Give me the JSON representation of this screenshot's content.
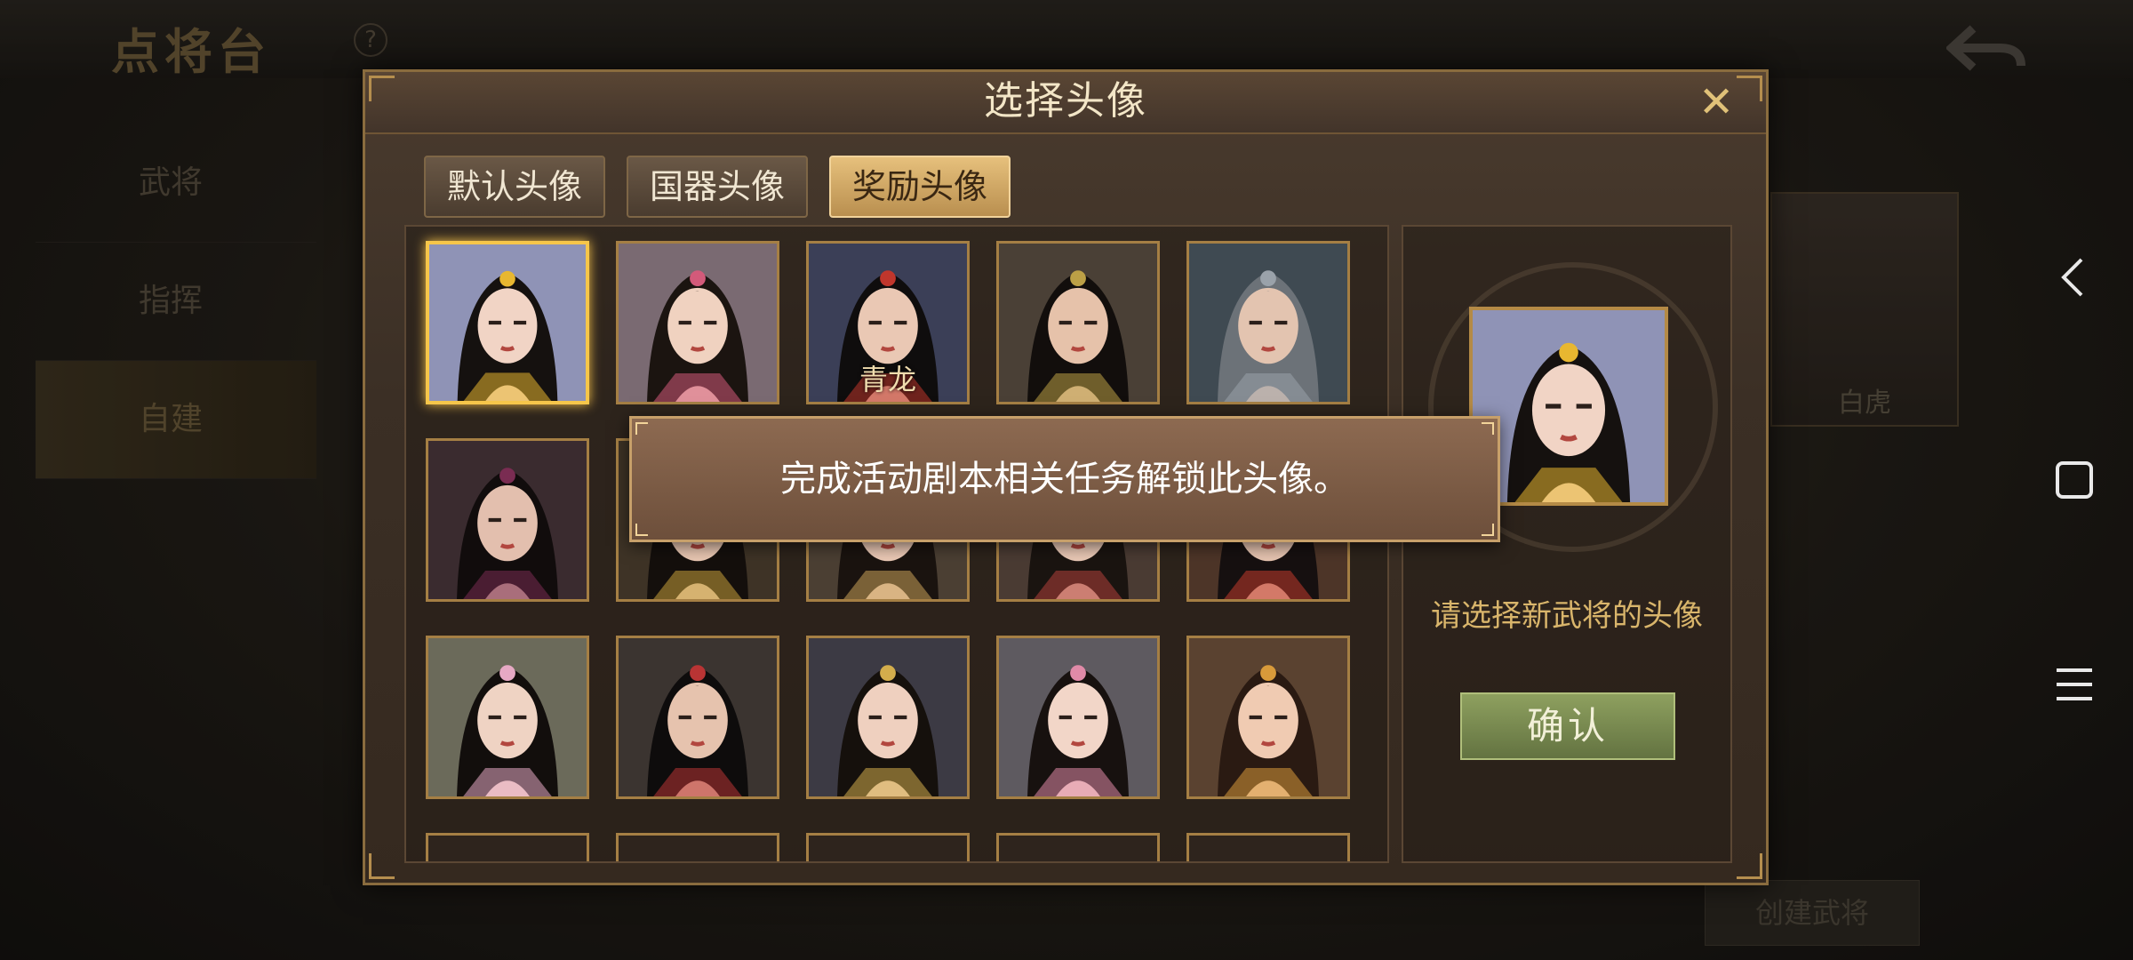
{
  "background": {
    "title": "点将台",
    "help_glyph": "?",
    "sidebar": [
      "武将",
      "指挥",
      "自建"
    ],
    "card_name": "白虎",
    "create_button": "创建武将"
  },
  "dialog": {
    "title": "选择头像",
    "close_glyph": "✕",
    "tabs": [
      {
        "label": "默认头像",
        "active": false
      },
      {
        "label": "国器头像",
        "active": false
      },
      {
        "label": "奖励头像",
        "active": true
      }
    ],
    "avatars": [
      {
        "label": "",
        "selected": true,
        "hair": "#15110f",
        "bg": "#8f93b6",
        "skin": "#f1d4c5",
        "accent": "#e8b730"
      },
      {
        "label": "",
        "selected": false,
        "hair": "#1b1410",
        "bg": "#7a6a72",
        "skin": "#f0d2c0",
        "accent": "#d35a7a"
      },
      {
        "label": "青龙",
        "selected": false,
        "hair": "#0f0d0d",
        "bg": "#3b3f57",
        "skin": "#eac8b4",
        "accent": "#c0362c"
      },
      {
        "label": "",
        "selected": false,
        "hair": "#120e0c",
        "bg": "#4a4036",
        "skin": "#e6c2aa",
        "accent": "#bca046"
      },
      {
        "label": "",
        "selected": false,
        "hair": "#6c7278",
        "bg": "#3f4a52",
        "skin": "#e3c4b0",
        "accent": "#9aa2aa"
      },
      {
        "label": "",
        "selected": false,
        "hair": "#110c0c",
        "bg": "#3a2b2f",
        "skin": "#e3bfae",
        "accent": "#7a2c52"
      },
      {
        "label": "",
        "selected": false,
        "hair": "#140f0c",
        "bg": "#3e3326",
        "skin": "#e9c7b2",
        "accent": "#c7a03a"
      },
      {
        "label": "",
        "selected": false,
        "hair": "#1a130f",
        "bg": "#4b3f33",
        "skin": "#eccab6",
        "accent": "#caa35a"
      },
      {
        "label": "",
        "selected": false,
        "hair": "#1a1410",
        "bg": "#4a3b33",
        "skin": "#eac9b6",
        "accent": "#b2403a"
      },
      {
        "label": "",
        "selected": false,
        "hair": "#161010",
        "bg": "#4d3528",
        "skin": "#e7c5b1",
        "accent": "#c33a2c"
      },
      {
        "label": "",
        "selected": false,
        "hair": "#120e0c",
        "bg": "#6b6a5a",
        "skin": "#efd3c3",
        "accent": "#e6a9c4"
      },
      {
        "label": "",
        "selected": false,
        "hair": "#0e0c0c",
        "bg": "#3b3430",
        "skin": "#e6c3ae",
        "accent": "#b93434"
      },
      {
        "label": "",
        "selected": false,
        "hair": "#15100c",
        "bg": "#3c3a44",
        "skin": "#efd0bf",
        "accent": "#d3ad4c"
      },
      {
        "label": "",
        "selected": false,
        "hair": "#17110f",
        "bg": "#5e5a60",
        "skin": "#f2d6c8",
        "accent": "#e08aa8"
      },
      {
        "label": "",
        "selected": false,
        "hair": "#2a1a12",
        "bg": "#5a4230",
        "skin": "#f0cbb2",
        "accent": "#d89a3a"
      }
    ],
    "preview": {
      "hint": "请选择新武将的头像",
      "confirm_label": "确认",
      "hair": "#15110f",
      "bg": "#8f93b6",
      "skin": "#f1d4c5",
      "accent": "#e8b730"
    },
    "tooltip": "完成活动剧本相关任务解锁此头像。"
  },
  "system_nav": {
    "back": "back-icon",
    "home": "home-icon",
    "menu": "menu-icon"
  }
}
